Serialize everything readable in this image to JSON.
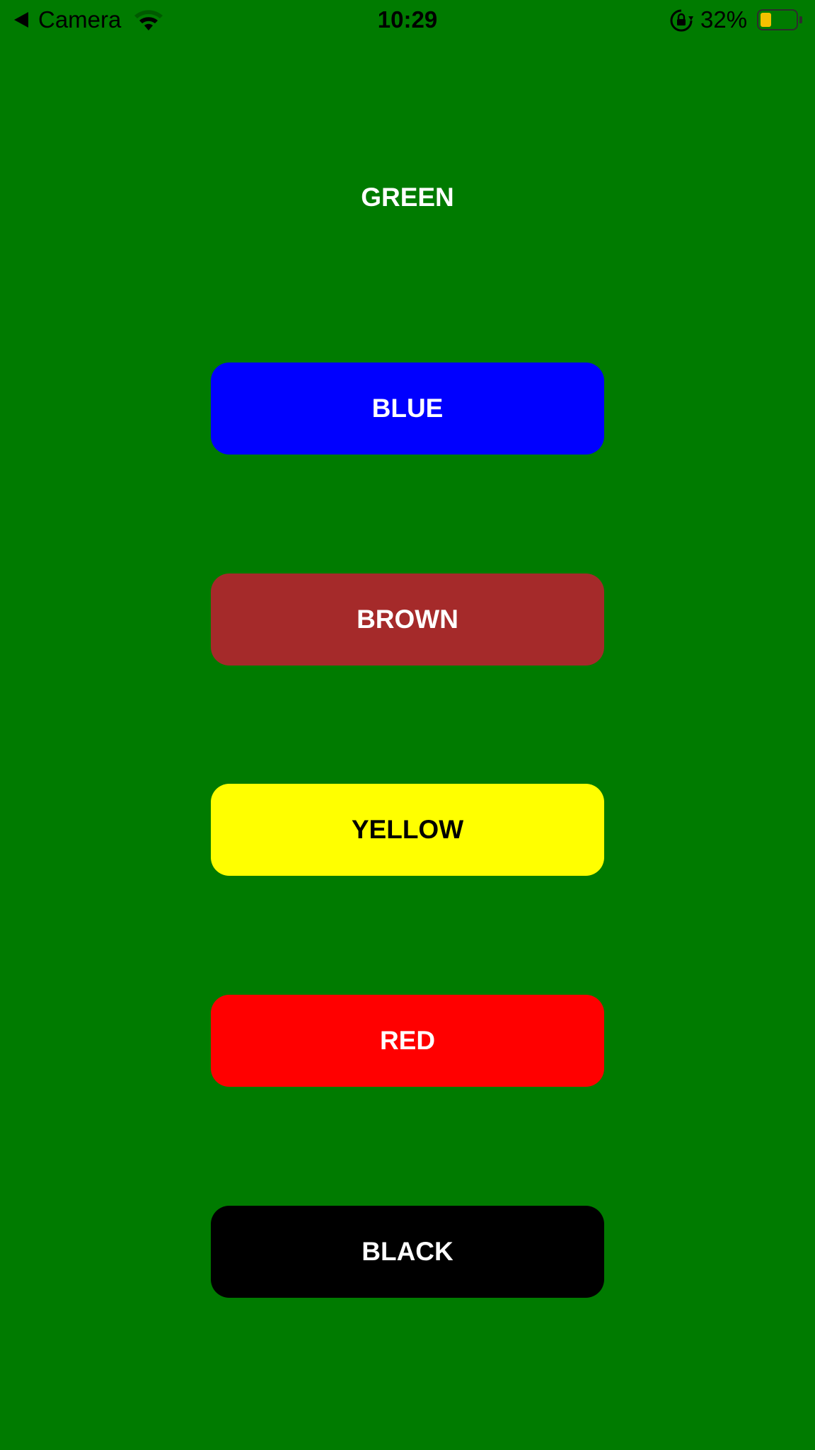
{
  "status_bar": {
    "back_label": "Camera",
    "time": "10:29",
    "battery_percent": "32%",
    "battery_level": 0.32,
    "battery_color": "#f5c000",
    "icons": [
      "back-arrow-icon",
      "wifi-icon",
      "lock-rotation-icon",
      "battery-icon"
    ]
  },
  "screen": {
    "background": "#007b00",
    "title": "GREEN",
    "title_color": "#ffffff"
  },
  "buttons": [
    {
      "label": "BLUE",
      "background": "#0000ff",
      "text_color": "#ffffff"
    },
    {
      "label": "BROWN",
      "background": "#a52a2a",
      "text_color": "#ffffff"
    },
    {
      "label": "YELLOW",
      "background": "#ffff00",
      "text_color": "#000000"
    },
    {
      "label": "RED",
      "background": "#ff0000",
      "text_color": "#ffffff"
    },
    {
      "label": "BLACK",
      "background": "#000000",
      "text_color": "#ffffff"
    }
  ]
}
